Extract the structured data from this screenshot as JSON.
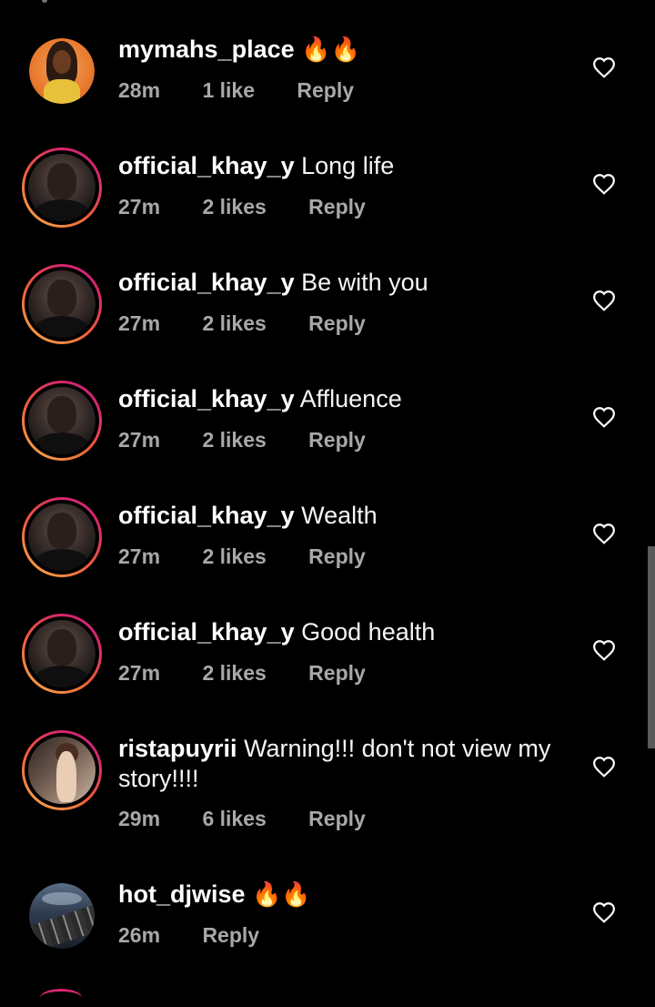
{
  "comments": [
    {
      "username": "mymahs_place",
      "text": "",
      "emoji": "🔥🔥",
      "time": "28m",
      "likes": "1 like",
      "reply": "Reply",
      "avatar": "mymahs-avatar",
      "has_story": false
    },
    {
      "username": "official_khay_y",
      "text": "Long life",
      "emoji": "",
      "time": "27m",
      "likes": "2 likes",
      "reply": "Reply",
      "avatar": "khay-avatar",
      "has_story": true
    },
    {
      "username": "official_khay_y",
      "text": "Be with you",
      "emoji": "",
      "time": "27m",
      "likes": "2 likes",
      "reply": "Reply",
      "avatar": "khay-avatar",
      "has_story": true
    },
    {
      "username": "official_khay_y",
      "text": "Affluence",
      "emoji": "",
      "time": "27m",
      "likes": "2 likes",
      "reply": "Reply",
      "avatar": "khay-avatar",
      "has_story": true
    },
    {
      "username": "official_khay_y",
      "text": "Wealth",
      "emoji": "",
      "time": "27m",
      "likes": "2 likes",
      "reply": "Reply",
      "avatar": "khay-avatar",
      "has_story": true
    },
    {
      "username": "official_khay_y",
      "text": "Good health",
      "emoji": "",
      "time": "27m",
      "likes": "2 likes",
      "reply": "Reply",
      "avatar": "khay-avatar",
      "has_story": true
    },
    {
      "username": "ristapuyrii",
      "text": "Warning!!! don't not view my story!!!!",
      "emoji": "",
      "time": "29m",
      "likes": "6 likes",
      "reply": "Reply",
      "avatar": "rista-avatar",
      "has_story": true
    },
    {
      "username": "hot_djwise",
      "text": "",
      "emoji": "🔥🔥",
      "time": "26m",
      "likes": "",
      "reply": "Reply",
      "avatar": "dj-avatar",
      "has_story": false
    }
  ],
  "icons": {
    "like": "heart-outline-icon"
  },
  "colors": {
    "background": "#000000",
    "text_primary": "#ffffff",
    "text_secondary": "#a8a8a8",
    "story_ring_start": "#f7b24a",
    "story_ring_end": "#c02a8a"
  }
}
